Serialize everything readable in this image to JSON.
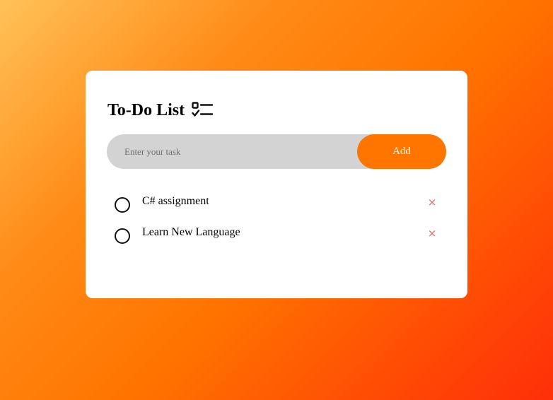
{
  "header": {
    "title": "To-Do List",
    "icon": "checklist-icon"
  },
  "input": {
    "value": "",
    "placeholder": "Enter your task"
  },
  "add_button": {
    "label": "Add"
  },
  "tasks": [
    {
      "text": "C# assignment",
      "checked": false,
      "delete_glyph": "×"
    },
    {
      "text": "Learn New Language",
      "checked": false,
      "delete_glyph": "×"
    }
  ],
  "colors": {
    "accent": "#ff7500",
    "input_background": "#d3d3d3",
    "delete": "#e8675a",
    "card": "#ffffff"
  }
}
